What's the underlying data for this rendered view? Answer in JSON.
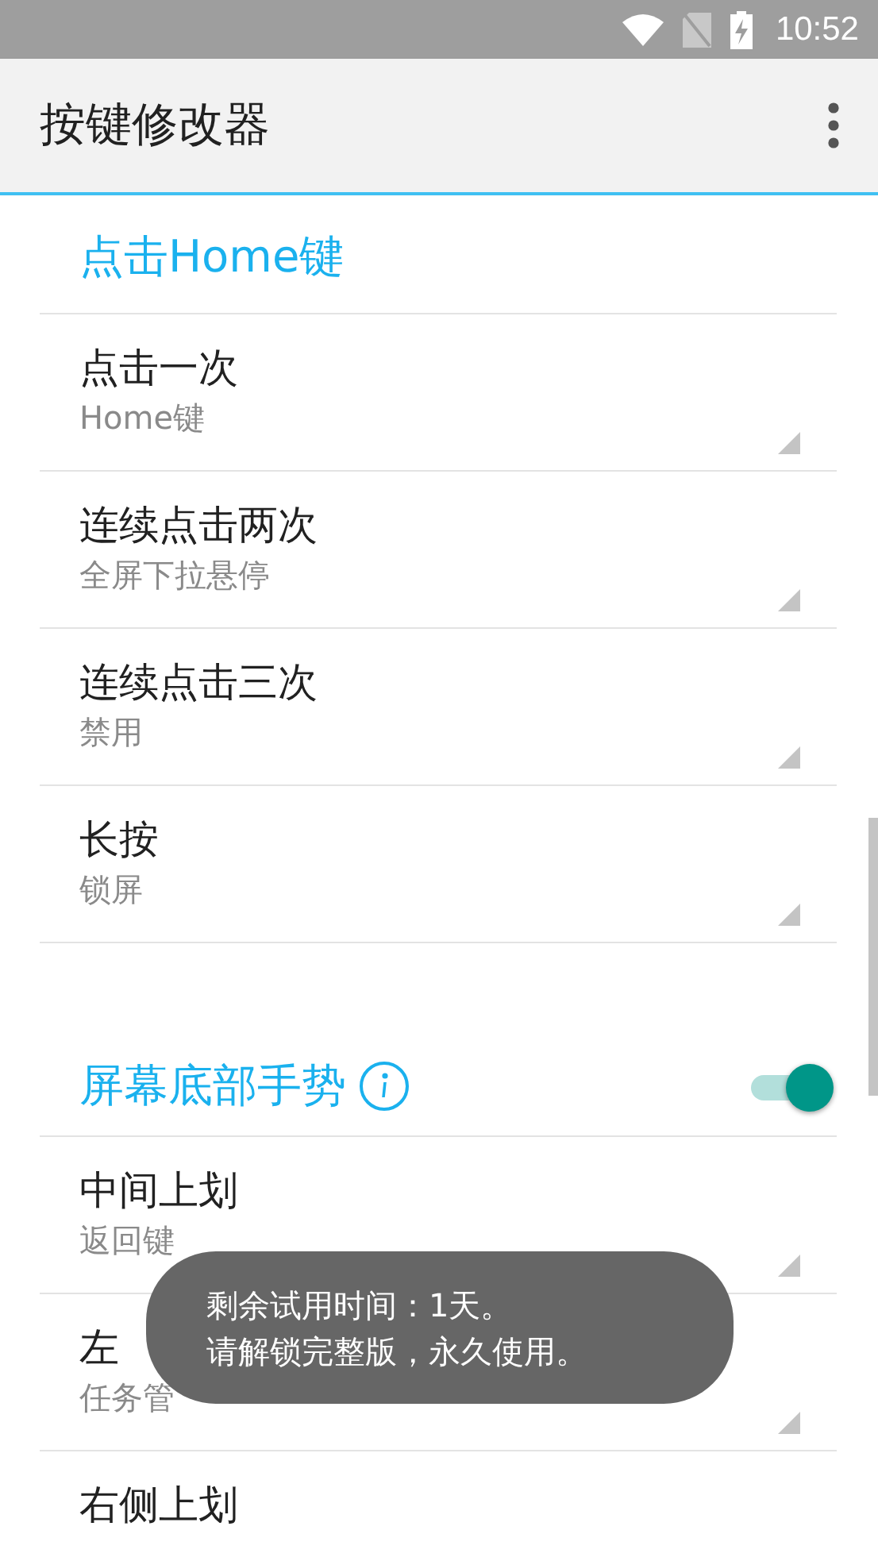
{
  "status_bar": {
    "time": "10:52"
  },
  "app_bar": {
    "title": "按键修改器"
  },
  "sections": [
    {
      "title": "点击Home键",
      "items": [
        {
          "title": "点击一次",
          "summary": "Home键"
        },
        {
          "title": "连续点击两次",
          "summary": "全屏下拉悬停"
        },
        {
          "title": "连续点击三次",
          "summary": "禁用"
        },
        {
          "title": "长按",
          "summary": "锁屏"
        }
      ]
    },
    {
      "title": "屏幕底部手势",
      "info": true,
      "switch": {
        "on": true
      },
      "items": [
        {
          "title": "中间上划",
          "summary": "返回键"
        },
        {
          "title": "左",
          "summary": "任务管"
        },
        {
          "title": "右侧上划"
        }
      ]
    }
  ],
  "toast": {
    "lines": [
      "剩余试用时间：1天。",
      "请解锁完整版，永久使用。"
    ]
  }
}
